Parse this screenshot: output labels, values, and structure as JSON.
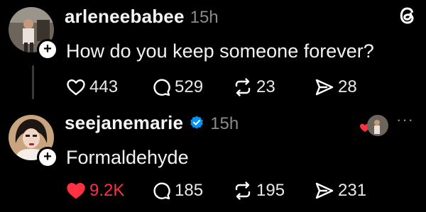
{
  "posts": [
    {
      "username": "arleneebabee",
      "time": "15h",
      "text": "How do you keep someone forever?",
      "likes": "443",
      "replies": "529",
      "reposts": "23",
      "shares": "28",
      "liked": false
    },
    {
      "username": "seejanemarie",
      "time": "15h",
      "text": "Formaldehyde",
      "likes": "9.2K",
      "replies": "185",
      "reposts": "195",
      "shares": "231",
      "liked": true,
      "verified": true
    }
  ],
  "icons": {
    "app_logo": "threads-logo-icon",
    "follow": "plus-icon",
    "like": "heart-icon",
    "reply": "speech-bubble-icon",
    "repost": "repost-arrows-icon",
    "share": "paper-plane-icon",
    "verified": "verified-check-icon",
    "more": "ellipsis-icon"
  },
  "colors": {
    "background": "#000000",
    "text": "#ffffff",
    "muted": "#8a8a8a",
    "like_active": "#ff3040",
    "verified": "#0095f6"
  },
  "more_label": "···"
}
